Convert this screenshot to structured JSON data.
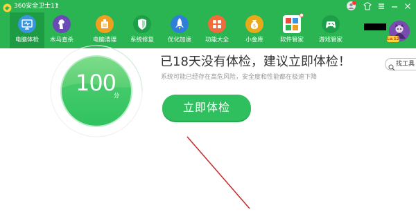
{
  "window": {
    "title": "360安全卫士11",
    "title_arrow": "↑"
  },
  "nav": [
    {
      "label": "电脑体检",
      "icon": "monitor-check-icon",
      "active": true
    },
    {
      "label": "木马查杀",
      "icon": "trojan-horse-icon",
      "active": false
    },
    {
      "label": "电脑清理",
      "icon": "cleanup-icon",
      "active": false
    },
    {
      "label": "系统修复",
      "icon": "shield-icon",
      "active": false
    },
    {
      "label": "优化加速",
      "icon": "rocket-icon",
      "active": false
    },
    {
      "label": "功能大全",
      "icon": "grid-icon",
      "active": false
    },
    {
      "label": "小金库",
      "icon": "money-bag-icon",
      "active": false
    },
    {
      "label": "软件管家",
      "icon": "software-icon",
      "active": false
    },
    {
      "label": "游戏管家",
      "icon": "gamepad-icon",
      "active": false
    }
  ],
  "user": {
    "level_badge": "Lv.12"
  },
  "tool_search": {
    "label": "找工具"
  },
  "checkup": {
    "score": "100",
    "score_unit": "分",
    "headline": "已18天没有体检，建议立即体检！",
    "subtext": "系统可能已经存在高危风险，安全度和性能都在极速下降",
    "button_label": "立即体检"
  },
  "colors": {
    "header_green": "#2bb552",
    "active_tab": "#1e9c44",
    "button_green": "#2fbf5e",
    "arrow_red": "#c62828"
  }
}
